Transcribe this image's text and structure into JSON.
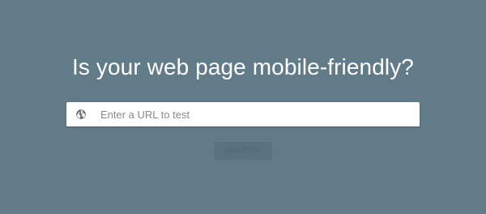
{
  "page": {
    "headline": "Is your web page mobile-friendly?",
    "background_color": "#627b89"
  },
  "url_field": {
    "icon": "globe-icon",
    "placeholder": "Enter a URL to test",
    "value": ""
  },
  "run_button": {
    "label": "RUN TEST",
    "state": "disabled"
  }
}
